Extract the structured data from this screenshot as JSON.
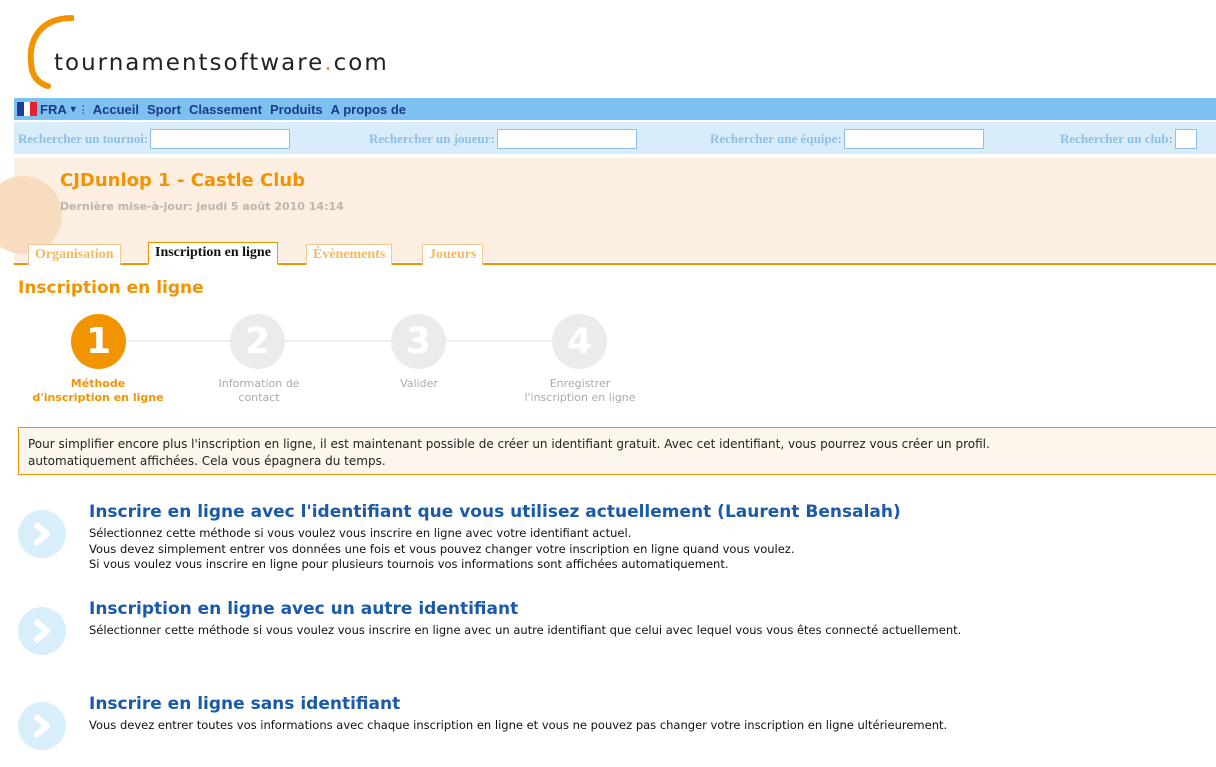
{
  "logo": {
    "name": "tournamentsoftware",
    "dot": ".",
    "tld": "com"
  },
  "colors": {
    "accent": "#f29400",
    "nav_bg": "#7ec0ef",
    "link": "#1a5aa8"
  },
  "nav": {
    "language": "FRA",
    "language_caret": "▾",
    "items": [
      "Accueil",
      "Sport",
      "Classement",
      "Produits",
      "A propos de"
    ]
  },
  "search": {
    "tournament_label": "Rechercher un tournoi:",
    "player_label": "Rechercher un joueur:",
    "team_label": "Rechercher une équipe:",
    "club_label": "Rechercher un club:"
  },
  "tournament": {
    "title": "CJDunlop 1 - Castle Club",
    "last_update": "Dernière mise-à-jour: jeudi 5 août 2010 14:14"
  },
  "tabs": [
    "Organisation",
    "Inscription en ligne",
    "Évènements",
    "Joueurs"
  ],
  "active_tab": "Inscription en ligne",
  "section_title": "Inscription en ligne",
  "steps": [
    {
      "number": "1",
      "line1": "Méthode",
      "line2": "d'inscription en ligne",
      "active": true
    },
    {
      "number": "2",
      "line1": "Information de",
      "line2": "contact",
      "active": false
    },
    {
      "number": "3",
      "line1": "Valider",
      "line2": "",
      "active": false
    },
    {
      "number": "4",
      "line1": "Enregistrer",
      "line2": "l'inscription en ligne",
      "active": false
    }
  ],
  "notice": {
    "line1": "Pour simplifier encore plus l'inscription en ligne, il est maintenant possible de créer un identifiant gratuit. Avec cet identifiant, vous pourrez vous créer un profil.",
    "line2": "automatiquement affichées. Cela vous épagnera du temps."
  },
  "options": [
    {
      "title": "Inscrire en ligne avec l'identifiant que vous utilisez actuellement (Laurent Bensalah)",
      "lines": [
        "Sélectionnez cette méthode si vous voulez vous inscrire en ligne avec votre identifiant actuel.",
        "Vous devez simplement entrer vos données une fois et vous pouvez changer votre inscription en ligne quand vous voulez.",
        "Si vous voulez vous inscrire en ligne pour plusieurs tournois vos informations sont affichées automatiquement."
      ]
    },
    {
      "title": "Inscription en ligne avec un autre identifiant",
      "lines": [
        "Sélectionner cette méthode si vous voulez vous inscrire en ligne avec un autre identifiant que celui avec lequel vous vous êtes connecté actuellement."
      ]
    },
    {
      "title": "Inscrire en ligne sans identifiant",
      "lines": [
        "Vous devez entrer toutes vos informations avec chaque inscription en ligne et vous ne pouvez pas changer votre inscription en ligne ultérieurement."
      ]
    }
  ]
}
